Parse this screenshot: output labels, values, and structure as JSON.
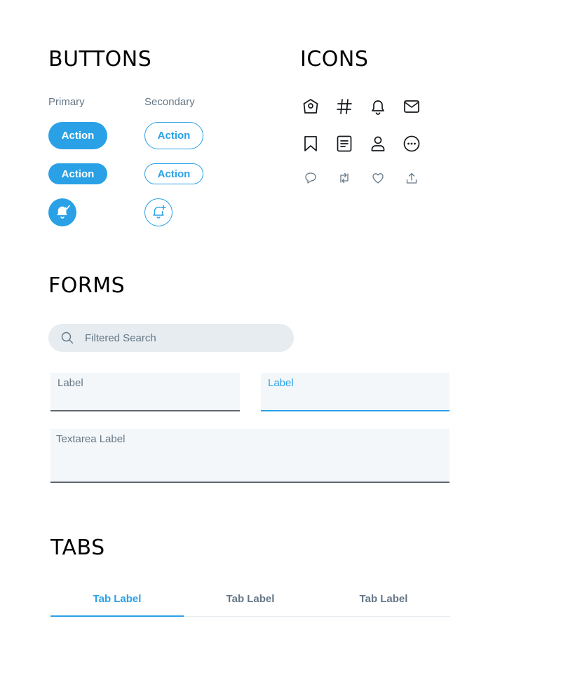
{
  "sections": {
    "buttons": "BUTTONS",
    "icons": "ICONS",
    "forms": "FORMS",
    "tabs": "TABS"
  },
  "buttons": {
    "primary_label": "Primary",
    "secondary_label": "Secondary",
    "action_label": "Action"
  },
  "icons": {
    "row1": [
      "home-icon",
      "hashtag-icon",
      "bell-icon",
      "mail-icon"
    ],
    "row2": [
      "bookmark-icon",
      "list-icon",
      "profile-icon",
      "more-icon"
    ],
    "row3": [
      "reply-icon",
      "retweet-icon",
      "like-icon",
      "share-icon"
    ]
  },
  "forms": {
    "search_placeholder": "Filtered Search",
    "field_label": "Label",
    "field_label_focused": "Label",
    "textarea_label": "Textarea Label"
  },
  "tabs": [
    {
      "label": "Tab Label",
      "active": true
    },
    {
      "label": "Tab Label",
      "active": false
    },
    {
      "label": "Tab Label",
      "active": false
    }
  ],
  "colors": {
    "accent": "#2aa1e7",
    "muted_text": "#657786",
    "field_bg": "#f4f7f9",
    "search_bg": "#e6ecf0"
  }
}
